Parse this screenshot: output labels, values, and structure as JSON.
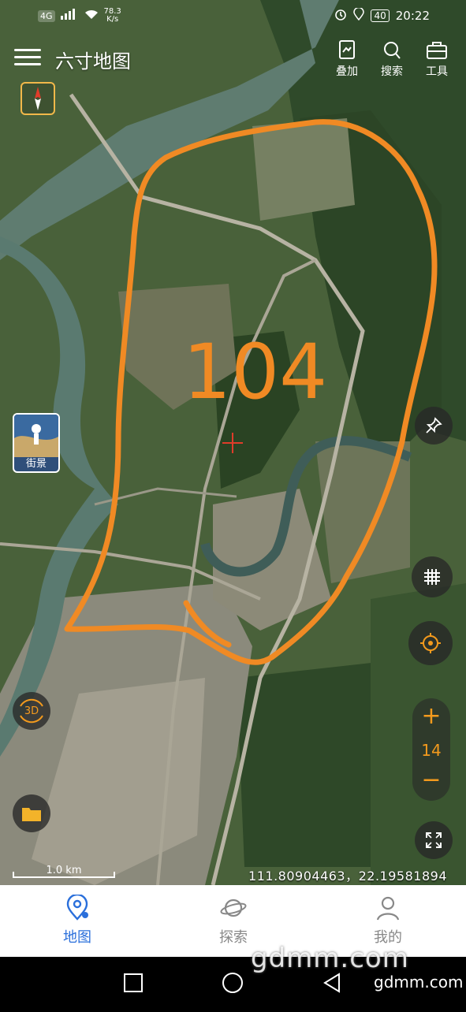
{
  "status_bar": {
    "network": "4G",
    "speed": "78.3",
    "speed_unit": "K/s",
    "battery": "40",
    "time": "20:22"
  },
  "app": {
    "title": "六寸地图"
  },
  "toolbar": {
    "overlay_label": "叠加",
    "search_label": "搜索",
    "tools_label": "工具"
  },
  "map": {
    "street_view_label": "街景",
    "view_3d_label": "3D",
    "zoom_level": "14",
    "zoom_in": "+",
    "zoom_out": "−",
    "scale_label": "1.0 km",
    "coordinates": "111.80904463，22.19581894",
    "annotation_text": "104",
    "colors": {
      "annotation": "#f08a24",
      "accent": "#f39a1d",
      "compass": "#f1b84a"
    }
  },
  "bottom_nav": {
    "items": [
      {
        "label": "地图",
        "icon": "map-pin-icon",
        "active": true
      },
      {
        "label": "探索",
        "icon": "planet-icon",
        "active": false
      },
      {
        "label": "我的",
        "icon": "user-icon",
        "active": false
      }
    ],
    "active_color": "#2a6fdb"
  },
  "watermark": {
    "big": "gdmm.com",
    "small": "gdmm.com"
  }
}
